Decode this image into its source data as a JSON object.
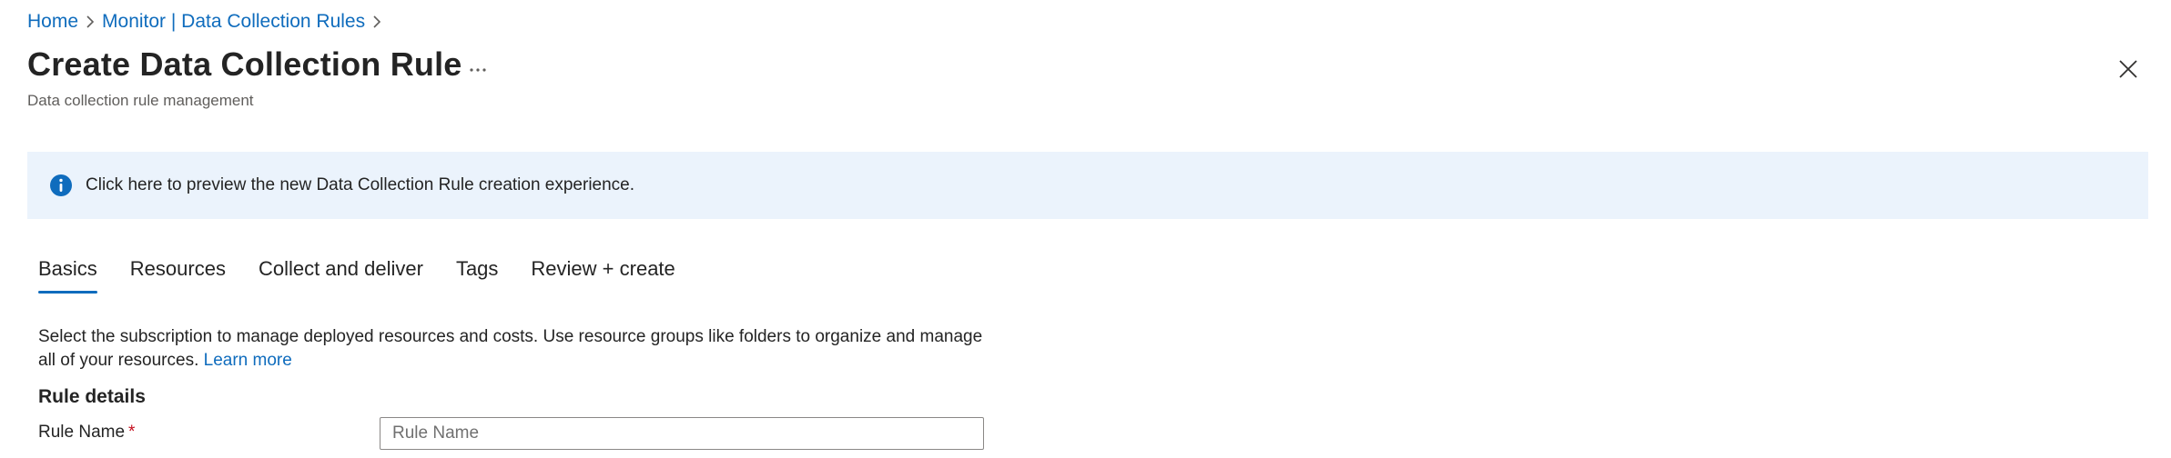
{
  "breadcrumb": {
    "items": [
      "Home",
      "Monitor | Data Collection Rules"
    ]
  },
  "header": {
    "title": "Create Data Collection Rule",
    "subtitle": "Data collection rule management",
    "more_icon": "more-horizontal-icon",
    "close_icon": "close-icon"
  },
  "banner": {
    "icon": "info-icon",
    "text": "Click here to preview the new Data Collection Rule creation experience."
  },
  "tabs": [
    {
      "label": "Basics",
      "active": true
    },
    {
      "label": "Resources",
      "active": false
    },
    {
      "label": "Collect and deliver",
      "active": false
    },
    {
      "label": "Tags",
      "active": false
    },
    {
      "label": "Review + create",
      "active": false
    }
  ],
  "description": {
    "text": "Select the subscription to manage deployed resources and costs. Use resource groups like folders to organize and manage all of your resources.",
    "link": "Learn more"
  },
  "rule_details": {
    "heading": "Rule details",
    "rule_name_label": "Rule Name",
    "required_mark": "*",
    "rule_name_value": "",
    "rule_name_placeholder": "Rule Name"
  },
  "colors": {
    "accent": "#0f6cbd",
    "banner_bg": "#ebf3fc",
    "required": "#c50f1f"
  }
}
